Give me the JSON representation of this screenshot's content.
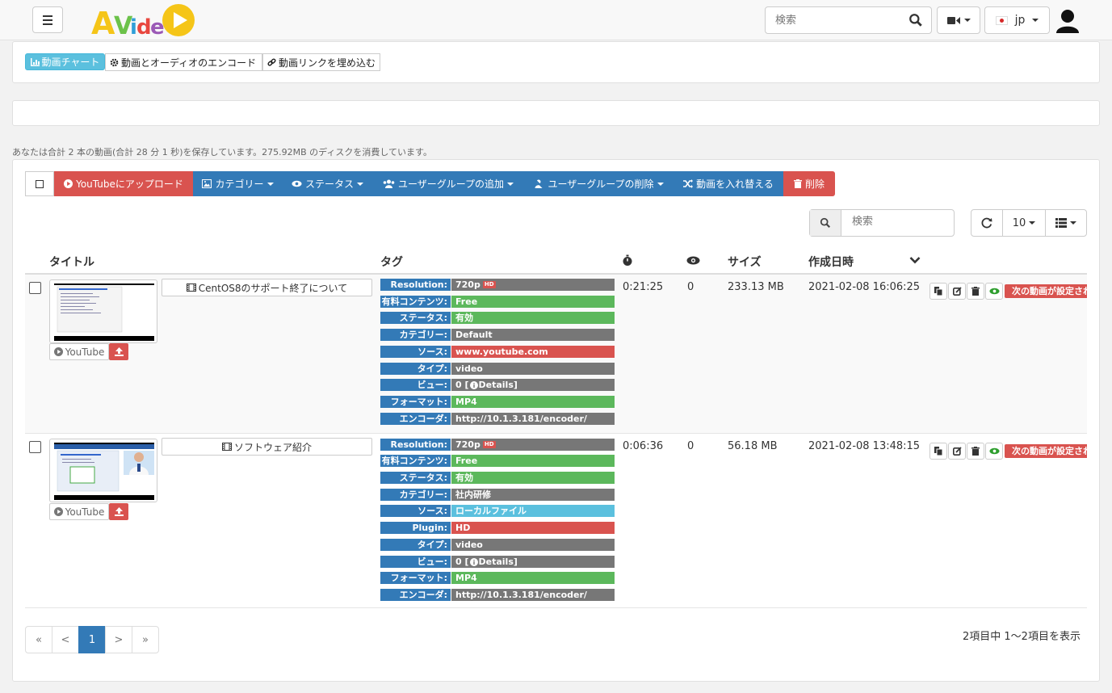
{
  "header": {
    "logo_text": "AVideo",
    "search_placeholder": "検索",
    "language": "jp"
  },
  "menu_tabs": [
    {
      "label": "動画チャート",
      "icon": "chart-icon"
    },
    {
      "label": "動画とオーディオのエンコード",
      "icon": "gear-icon"
    },
    {
      "label": "動画リンクを埋め込む",
      "icon": "link-icon"
    }
  ],
  "summary": "あなたは合計 2 本の動画(合計 28 分 1 秒)を保存しています。275.92MB のディスクを消費しています。",
  "toolbar": {
    "upload_youtube": "YouTubeにアップロード",
    "category": "カテゴリー",
    "status": "ステータス",
    "add_group": "ユーザーグループの追加",
    "remove_group": "ユーザーグループの削除",
    "swap": "動画を入れ替える",
    "delete": "削除"
  },
  "table_controls": {
    "search_placeholder": "検索",
    "page_size": "10"
  },
  "columns": {
    "title": "タイトル",
    "tags": "タグ",
    "size": "サイズ",
    "created": "作成日時"
  },
  "colors": {
    "primary": "#337ab7",
    "danger": "#d9534f",
    "success": "#5cb85c",
    "info": "#5bc0de",
    "default": "#777777"
  },
  "rows": [
    {
      "title": "CentOS8のサポート終了について",
      "youtube_label": "YouTube",
      "duration": "0:21:25",
      "views": "0",
      "size": "233.13 MB",
      "created": "2021-02-08 16:06:25",
      "next_video": "次の動画が設定されていません",
      "tags": [
        {
          "key": "Resolution:",
          "value": "720p",
          "color": "#777777",
          "hd": true
        },
        {
          "key": "有料コンテンツ:",
          "value": "Free",
          "color": "#5cb85c"
        },
        {
          "key": "ステータス:",
          "value": "有効",
          "color": "#5cb85c"
        },
        {
          "key": "カテゴリー:",
          "value": "Default",
          "color": "#777777"
        },
        {
          "key": "ソース:",
          "value": "www.youtube.com",
          "color": "#d9534f"
        },
        {
          "key": "タイプ:",
          "value": "video",
          "color": "#777777"
        },
        {
          "key": "ビュー:",
          "value": "0 [",
          "color": "#777777",
          "details": "Details]"
        },
        {
          "key": "フォーマット:",
          "value": "MP4",
          "color": "#5cb85c"
        },
        {
          "key": "エンコーダ:",
          "value": "http://10.1.3.181/encoder/",
          "color": "#777777"
        }
      ]
    },
    {
      "title": "ソフトウェア紹介",
      "youtube_label": "YouTube",
      "duration": "0:06:36",
      "views": "0",
      "size": "56.18 MB",
      "created": "2021-02-08 13:48:15",
      "next_video": "次の動画が設定されていません",
      "tags": [
        {
          "key": "Resolution:",
          "value": "720p",
          "color": "#777777",
          "hd": true
        },
        {
          "key": "有料コンテンツ:",
          "value": "Free",
          "color": "#5cb85c"
        },
        {
          "key": "ステータス:",
          "value": "有効",
          "color": "#5cb85c"
        },
        {
          "key": "カテゴリー:",
          "value": "社内研修",
          "color": "#777777"
        },
        {
          "key": "ソース:",
          "value": "ローカルファイル",
          "color": "#5bc0de"
        },
        {
          "key": "Plugin:",
          "value": "HD",
          "color": "#d9534f"
        },
        {
          "key": "タイプ:",
          "value": "video",
          "color": "#777777"
        },
        {
          "key": "ビュー:",
          "value": "0 [",
          "color": "#777777",
          "details": "Details]"
        },
        {
          "key": "フォーマット:",
          "value": "MP4",
          "color": "#5cb85c"
        },
        {
          "key": "エンコーダ:",
          "value": "http://10.1.3.181/encoder/",
          "color": "#777777"
        }
      ]
    }
  ],
  "pagination": {
    "first": "«",
    "prev": "<",
    "current": "1",
    "next": ">",
    "last": "»",
    "info": "2項目中 1～2項目を表示"
  }
}
